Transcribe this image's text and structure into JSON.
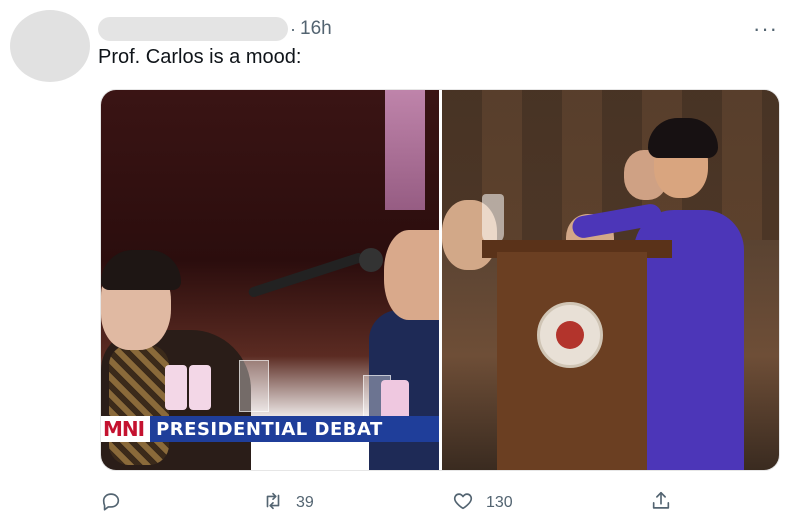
{
  "tweet": {
    "separator": "·",
    "time": "16h",
    "more_label": "···",
    "text": "Prof. Carlos is a mood:"
  },
  "media": {
    "left_photo": {
      "ticker_network": "MNI",
      "ticker_title": "PRESIDENTIAL DEBAT"
    },
    "right_photo": {}
  },
  "actions": {
    "reply": {
      "icon": "reply-icon",
      "count": ""
    },
    "retweet": {
      "icon": "retweet-icon",
      "count": "39"
    },
    "like": {
      "icon": "heart-icon",
      "count": "130"
    },
    "share": {
      "icon": "share-icon",
      "count": ""
    }
  },
  "colors": {
    "text": "#0f1419",
    "muted": "#536471",
    "ticker_red": "#c4122f",
    "ticker_blue": "#1f3e9a"
  }
}
